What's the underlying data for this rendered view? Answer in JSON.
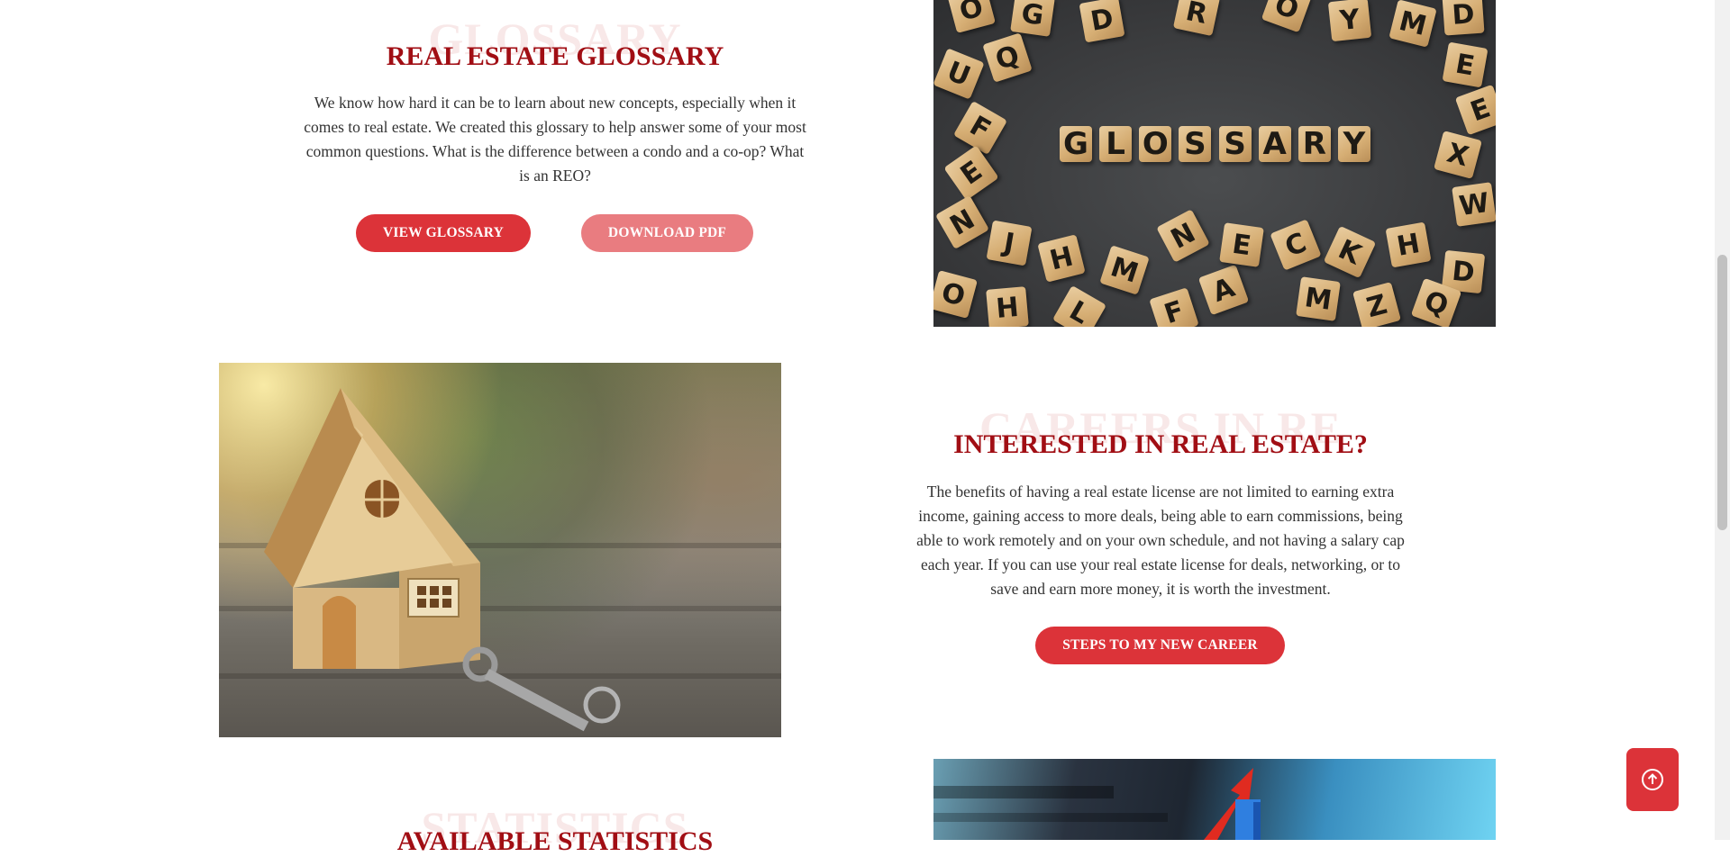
{
  "glossary_section": {
    "watermark": "GLOSSARY",
    "title": "REAL ESTATE GLOSSARY",
    "description": "We know how hard it can be to learn about new concepts, especially when it comes to real estate. We created this glossary to help answer some of your most common questions. What is the difference between a condo and a co-op? What is an REO?",
    "view_button": "VIEW GLOSSARY",
    "download_button": "DOWNLOAD PDF",
    "image_word": "GLOSSARY"
  },
  "careers_section": {
    "watermark": "CAREERS IN RE",
    "title": "INTERESTED IN REAL ESTATE?",
    "description": "The benefits of having a real estate license are not limited to earning extra income, gaining access to more deals, being able to earn commissions, being able to work remotely and on your own schedule, and not having a salary cap each year. If you can use your real estate license for deals, networking, or to save and earn more money, it is worth the investment.",
    "cta_button": "STEPS TO MY NEW CAREER"
  },
  "statistics_section": {
    "watermark": "STATISTICS",
    "title": "AVAILABLE STATISTICS"
  },
  "theme": {
    "accent": "#dc3339",
    "accent_soft": "#e97c80",
    "heading": "#a10e14"
  },
  "icons": {
    "scroll_top": "arrow-up-circle-icon"
  }
}
